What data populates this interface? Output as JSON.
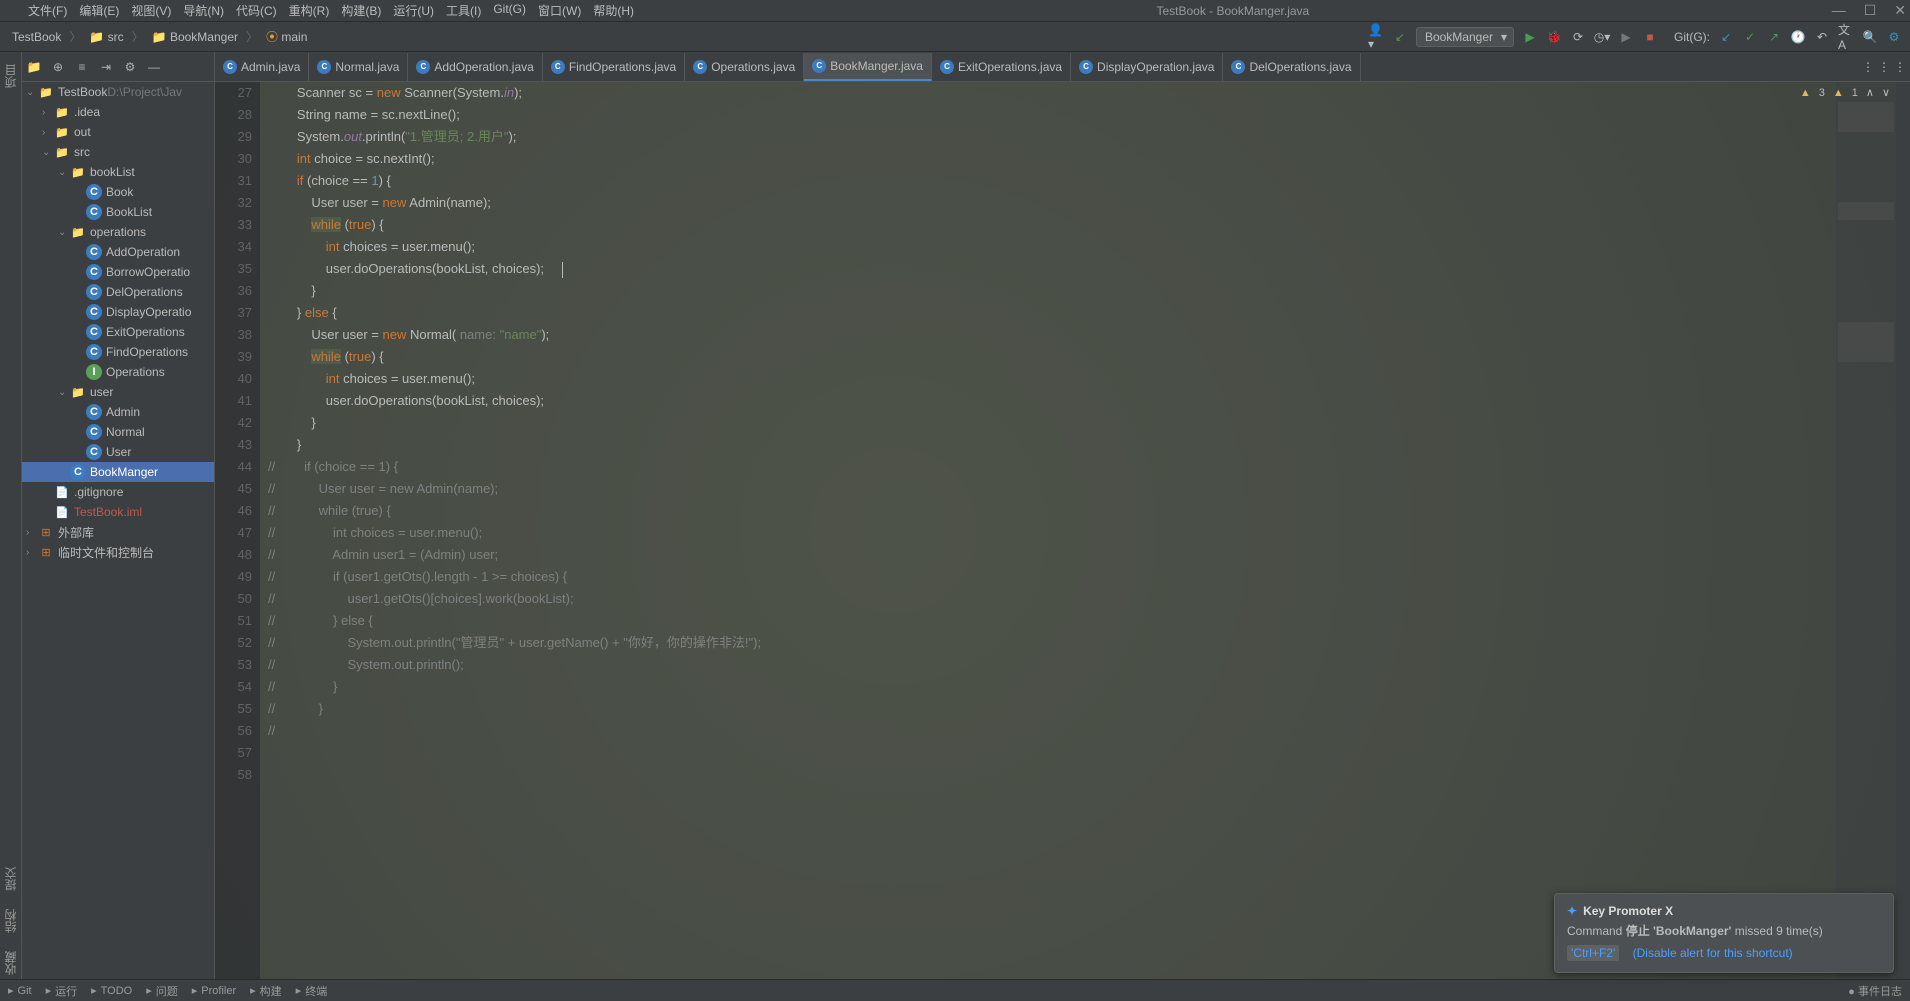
{
  "window_title": "TestBook - BookManger.java",
  "menus": [
    "文件(F)",
    "编辑(E)",
    "视图(V)",
    "导航(N)",
    "代码(C)",
    "重构(R)",
    "构建(B)",
    "运行(U)",
    "工具(I)",
    "Git(G)",
    "窗口(W)",
    "帮助(H)"
  ],
  "breadcrumb": [
    "TestBook",
    "src",
    "BookManger",
    "main"
  ],
  "run_config": "BookManger",
  "git_label": "Git(G):",
  "tabs": [
    {
      "label": "Admin.java",
      "active": false
    },
    {
      "label": "Normal.java",
      "active": false
    },
    {
      "label": "AddOperation.java",
      "active": false
    },
    {
      "label": "FindOperations.java",
      "active": false
    },
    {
      "label": "Operations.java",
      "active": false
    },
    {
      "label": "BookManger.java",
      "active": true
    },
    {
      "label": "ExitOperations.java",
      "active": false
    },
    {
      "label": "DisplayOperation.java",
      "active": false
    },
    {
      "label": "DelOperations.java",
      "active": false
    }
  ],
  "inspection": {
    "warn1": "3",
    "warn2": "1"
  },
  "tree": [
    {
      "depth": 0,
      "exp": "v",
      "icon": "folder",
      "label": "TestBook",
      "suffix": "D:\\Project\\Jav"
    },
    {
      "depth": 1,
      "exp": ">",
      "icon": "folder",
      "label": ".idea"
    },
    {
      "depth": 1,
      "exp": ">",
      "icon": "folder",
      "label": "out"
    },
    {
      "depth": 1,
      "exp": "v",
      "icon": "folder",
      "label": "src"
    },
    {
      "depth": 2,
      "exp": "v",
      "icon": "folder",
      "label": "bookList"
    },
    {
      "depth": 3,
      "exp": "",
      "icon": "class",
      "label": "Book"
    },
    {
      "depth": 3,
      "exp": "",
      "icon": "class",
      "label": "BookList"
    },
    {
      "depth": 2,
      "exp": "v",
      "icon": "folder",
      "label": "operations"
    },
    {
      "depth": 3,
      "exp": "",
      "icon": "class",
      "label": "AddOperation"
    },
    {
      "depth": 3,
      "exp": "",
      "icon": "class",
      "label": "BorrowOperatio"
    },
    {
      "depth": 3,
      "exp": "",
      "icon": "class",
      "label": "DelOperations"
    },
    {
      "depth": 3,
      "exp": "",
      "icon": "class",
      "label": "DisplayOperatio"
    },
    {
      "depth": 3,
      "exp": "",
      "icon": "class",
      "label": "ExitOperations"
    },
    {
      "depth": 3,
      "exp": "",
      "icon": "class",
      "label": "FindOperations"
    },
    {
      "depth": 3,
      "exp": "",
      "icon": "iface",
      "label": "Operations"
    },
    {
      "depth": 2,
      "exp": "v",
      "icon": "folder",
      "label": "user"
    },
    {
      "depth": 3,
      "exp": "",
      "icon": "class",
      "label": "Admin"
    },
    {
      "depth": 3,
      "exp": "",
      "icon": "class",
      "label": "Normal"
    },
    {
      "depth": 3,
      "exp": "",
      "icon": "class",
      "label": "User"
    },
    {
      "depth": 2,
      "exp": "",
      "icon": "class",
      "label": "BookManger",
      "selected": true
    },
    {
      "depth": 1,
      "exp": "",
      "icon": "file",
      "label": ".gitignore"
    },
    {
      "depth": 1,
      "exp": "",
      "icon": "file",
      "label": "TestBook.iml",
      "class": "red"
    },
    {
      "depth": 0,
      "exp": ">",
      "icon": "lib",
      "label": "外部库"
    },
    {
      "depth": 0,
      "exp": ">",
      "icon": "lib",
      "label": "临时文件和控制台"
    }
  ],
  "line_start": 27,
  "line_count": 32,
  "code_lines": [
    {
      "html": "        Scanner sc = <span class='kw'>new</span> Scanner(System.<span class='fld'>in</span>);"
    },
    {
      "html": "        String name = sc.nextLine();"
    },
    {
      "html": "        System.<span class='fld'>out</span>.println(<span class='str'>\"1.管理员; 2.用户\"</span>);"
    },
    {
      "html": "        <span class='kw'>int</span> choice = sc.nextInt();"
    },
    {
      "html": "        <span class='kw'>if</span> (choice == <span class='num'>1</span>) {"
    },
    {
      "html": "            User user = <span class='kw'>new</span> Admin(name);"
    },
    {
      "html": "            <span class='kw hl'>while</span> (<span class='kw'>true</span>) {"
    },
    {
      "html": "                <span class='kw'>int</span> choices = user.menu();"
    },
    {
      "html": "                user.doOperations(bookList, choices);     <span class='cursor'></span>"
    },
    {
      "html": "            }"
    },
    {
      "html": "        } <span class='kw'>else</span> {"
    },
    {
      "html": "            User user = <span class='kw'>new</span> Normal( <span class='param'>name:</span> <span class='str'>\"name\"</span>);"
    },
    {
      "html": "            <span class='kw hl'>while</span> (<span class='kw'>true</span>) {"
    },
    {
      "html": "                <span class='kw'>int</span> choices = user.menu();"
    },
    {
      "html": "                user.doOperations(bookList, choices);"
    },
    {
      "html": "            }"
    },
    {
      "html": "        }"
    },
    {
      "html": ""
    },
    {
      "html": ""
    },
    {
      "html": "<span class='com'>//        if (choice == 1) {</span>"
    },
    {
      "html": "<span class='com'>//            User user = new Admin(name);</span>"
    },
    {
      "html": "<span class='com'>//            while (true) {</span>"
    },
    {
      "html": "<span class='com'>//                int choices = user.menu();</span>"
    },
    {
      "html": "<span class='com'>//                Admin user1 = (Admin) user;</span>"
    },
    {
      "html": "<span class='com'>//                if (user1.getOts().length - 1 >= choices) {</span>"
    },
    {
      "html": "<span class='com'>//                    user1.getOts()[choices].work(bookList);</span>"
    },
    {
      "html": "<span class='com'>//                } else {</span>"
    },
    {
      "html": "<span class='com'>//                    System.out.println(\"管理员\" + user.getName() + \"你好，你的操作非法!\");</span>"
    },
    {
      "html": "<span class='com'>//                    System.out.println();</span>"
    },
    {
      "html": "<span class='com'>//                }</span>"
    },
    {
      "html": "<span class='com'>//            }</span>"
    },
    {
      "html": "<span class='com'>//</span>"
    }
  ],
  "notification": {
    "title": "Key Promoter X",
    "body_prefix": "Command ",
    "body_cmd": "停止 'BookManger'",
    "body_suffix": " missed 9 time(s)",
    "key": "'Ctrl+F2'",
    "link": "(Disable alert for this shortcut)"
  },
  "statusbar": {
    "items": [
      "Git",
      "运行",
      "TODO",
      "问题",
      "Profiler",
      "构建",
      "终端"
    ],
    "right": "事件日志"
  }
}
